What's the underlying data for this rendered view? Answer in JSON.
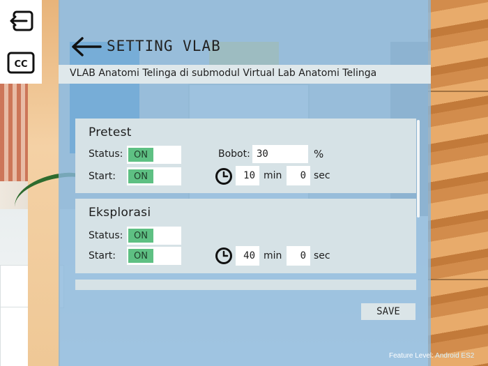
{
  "header": {
    "title": "SETTING VLAB",
    "subtitle": "VLAB Anatomi Telinga di submodul Virtual Lab Anatomi Telinga"
  },
  "side_buttons": [
    {
      "icon": "exit-icon"
    },
    {
      "icon": "cc-icon",
      "label": "CC"
    }
  ],
  "sections": [
    {
      "title": "Pretest",
      "status_label": "Status:",
      "status_value": "ON",
      "start_label": "Start:",
      "start_value": "ON",
      "bobot_label": "Bobot:",
      "bobot_value": "30",
      "bobot_unit": "%",
      "minutes": "10",
      "min_label": "min",
      "seconds": "0",
      "sec_label": "sec"
    },
    {
      "title": "Eksplorasi",
      "status_label": "Status:",
      "status_value": "ON",
      "start_label": "Start:",
      "start_value": "ON",
      "minutes": "40",
      "min_label": "min",
      "seconds": "0",
      "sec_label": "sec"
    }
  ],
  "save_label": "SAVE",
  "feature_level": {
    "label": "Feature Level:",
    "value": "Android ES2"
  },
  "colors": {
    "overlay": "#89b7db",
    "toggle_on": "#5ec083",
    "card": "#d6e2e6"
  }
}
